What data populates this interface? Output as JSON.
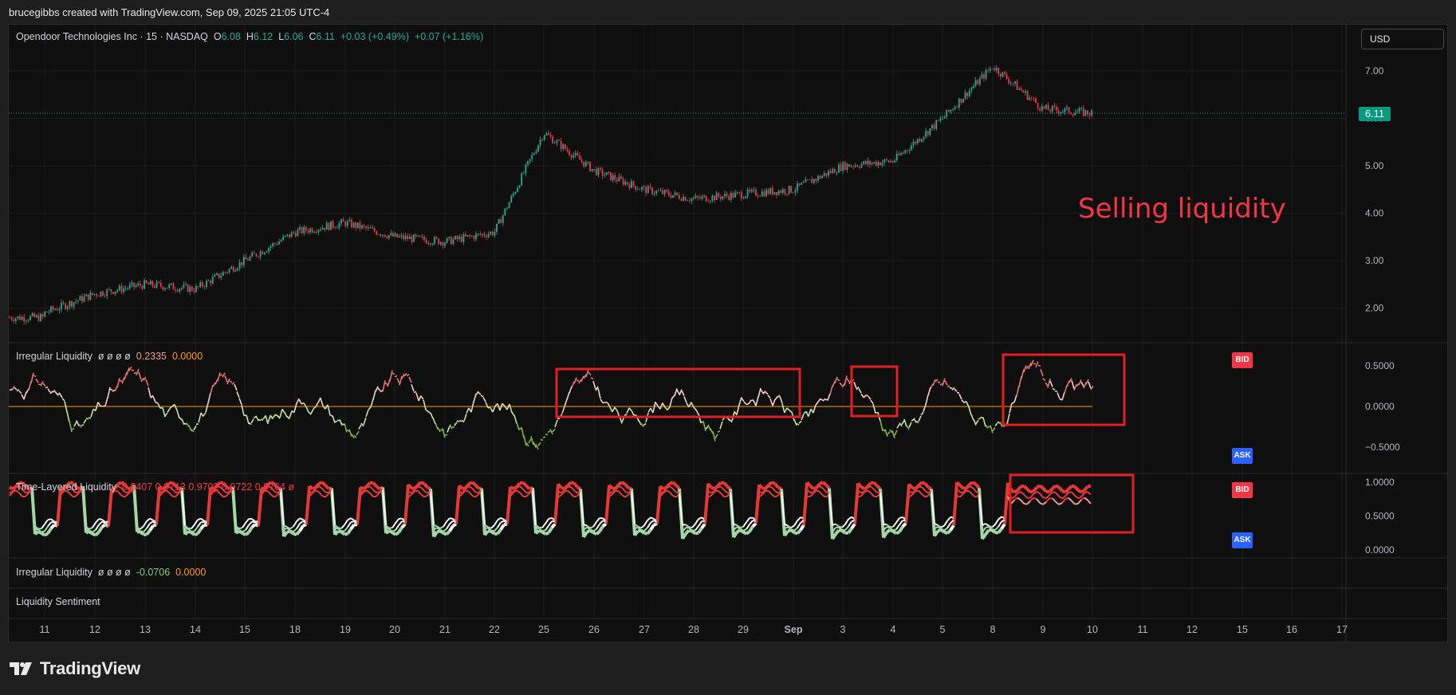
{
  "header": {
    "attribution": "brucegibbs created with TradingView.com, Sep 09, 2025 21:05 UTC-4"
  },
  "main_legend": {
    "symbol": "Opendoor Technologies Inc · 15 · NASDAQ",
    "o_label": "O",
    "o_value": "6.08",
    "h_label": "H",
    "h_value": "6.12",
    "l_label": "L",
    "l_value": "6.06",
    "c_label": "C",
    "c_value": "6.11",
    "change": "+0.03 (+0.49%)",
    "change2": "+0.07 (+1.16%)"
  },
  "currency": "USD",
  "last_price": "6.11",
  "annotation": "Selling liquidity",
  "price_axis": [
    "7.00",
    "6.00",
    "5.00",
    "4.00",
    "3.00",
    "2.00"
  ],
  "pane1": {
    "title": "Irregular Liquidity",
    "nulls": "ø ø ø ø",
    "value1": "0.2335",
    "value2": "0.0000",
    "axis": [
      "0.5000",
      "0.0000",
      "−0.5000"
    ]
  },
  "pane2": {
    "title": "Time-Layered Liquidity",
    "values": "0.3407 0.9713 0.9702 0.9722 0.9764 ø",
    "axis": [
      "1.0000",
      "0.5000",
      "0.0000"
    ]
  },
  "pane3": {
    "title": "Irregular Liquidity",
    "nulls": "ø ø ø ø",
    "value1": "-0.0706",
    "value2": "0.0000"
  },
  "pane4": {
    "title": "Liquidity Sentiment"
  },
  "badges": {
    "bid": "BID",
    "ask": "ASK"
  },
  "time_axis": [
    "11",
    "12",
    "13",
    "14",
    "15",
    "18",
    "19",
    "20",
    "21",
    "22",
    "25",
    "26",
    "27",
    "28",
    "29",
    "Sep",
    "3",
    "4",
    "5",
    "8",
    "9",
    "10",
    "11",
    "12",
    "15",
    "16",
    "17"
  ],
  "brand": "TradingView",
  "colors": {
    "up": "#22ab94",
    "down": "#f23645",
    "background": "#0f0f0f",
    "box": "#e01f1f",
    "zero_line": "#ff9800"
  },
  "chart_data": {
    "type": "line",
    "title": "Opendoor Technologies Inc · 15 · NASDAQ",
    "x": [
      "11",
      "12",
      "13",
      "14",
      "15",
      "18",
      "19",
      "20",
      "21",
      "22",
      "25",
      "26",
      "27",
      "28",
      "29",
      "Sep",
      "3",
      "4",
      "5",
      "8",
      "9",
      "10"
    ],
    "series": [
      {
        "name": "Price",
        "values": [
          1.9,
          2.3,
          2.5,
          2.4,
          3.0,
          3.6,
          3.8,
          3.5,
          3.4,
          3.6,
          5.7,
          4.9,
          4.5,
          4.3,
          4.4,
          4.5,
          5.0,
          5.1,
          6.0,
          7.1,
          6.2,
          6.11
        ]
      }
    ],
    "ylim": [
      1.6,
      7.4
    ]
  }
}
